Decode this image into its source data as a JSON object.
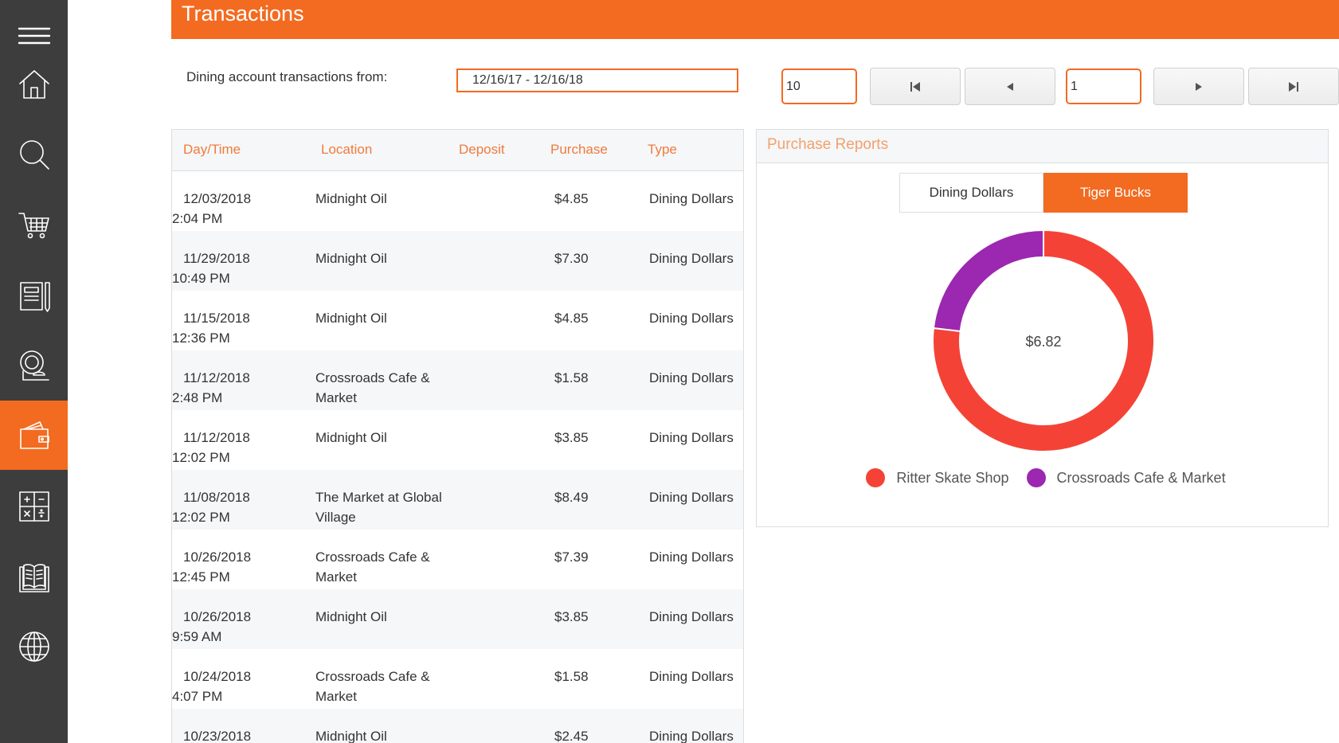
{
  "header": {
    "title": "Transactions"
  },
  "filter": {
    "label": "Dining account transactions from:",
    "date_range": "12/16/17 - 12/16/18"
  },
  "pagination": {
    "page_size": "10",
    "page_number": "1"
  },
  "sidebar": {
    "items": [
      {
        "icon": "menu-icon"
      },
      {
        "icon": "home-icon"
      },
      {
        "icon": "search-icon"
      },
      {
        "icon": "cart-icon"
      },
      {
        "icon": "notebook-icon"
      },
      {
        "icon": "dining-icon"
      },
      {
        "icon": "wallet-icon",
        "active": true
      },
      {
        "icon": "calculator-icon"
      },
      {
        "icon": "book-icon"
      },
      {
        "icon": "globe-icon"
      }
    ]
  },
  "table": {
    "headers": [
      "Day/Time",
      "Location",
      "Deposit",
      "Purchase",
      "Type"
    ],
    "rows": [
      {
        "date": "12/03/2018",
        "time": "2:04 PM",
        "location": "Midnight Oil",
        "deposit": "",
        "purchase": "$4.85",
        "type": "Dining Dollars"
      },
      {
        "date": "11/29/2018",
        "time": "10:49 PM",
        "location": "Midnight Oil",
        "deposit": "",
        "purchase": "$7.30",
        "type": "Dining Dollars"
      },
      {
        "date": "11/15/2018",
        "time": "12:36 PM",
        "location": "Midnight Oil",
        "deposit": "",
        "purchase": "$4.85",
        "type": "Dining Dollars"
      },
      {
        "date": "11/12/2018",
        "time": "2:48 PM",
        "location": "Crossroads Cafe & Market",
        "deposit": "",
        "purchase": "$1.58",
        "type": "Dining Dollars"
      },
      {
        "date": "11/12/2018",
        "time": "12:02 PM",
        "location": "Midnight Oil",
        "deposit": "",
        "purchase": "$3.85",
        "type": "Dining Dollars"
      },
      {
        "date": "11/08/2018",
        "time": "12:02 PM",
        "location": "The Market at Global Village",
        "deposit": "",
        "purchase": "$8.49",
        "type": "Dining Dollars"
      },
      {
        "date": "10/26/2018",
        "time": "12:45 PM",
        "location": "Crossroads Cafe & Market",
        "deposit": "",
        "purchase": "$7.39",
        "type": "Dining Dollars"
      },
      {
        "date": "10/26/2018",
        "time": "9:59 AM",
        "location": "Midnight Oil",
        "deposit": "",
        "purchase": "$3.85",
        "type": "Dining Dollars"
      },
      {
        "date": "10/24/2018",
        "time": "4:07 PM",
        "location": "Crossroads Cafe & Market",
        "deposit": "",
        "purchase": "$1.58",
        "type": "Dining Dollars"
      },
      {
        "date": "10/23/2018",
        "time": "",
        "location": "Midnight Oil",
        "deposit": "",
        "purchase": "$2.45",
        "type": "Dining Dollars"
      }
    ]
  },
  "report": {
    "title": "Purchase Reports",
    "tabs": [
      {
        "label": "Dining Dollars",
        "active": false
      },
      {
        "label": "Tiger Bucks",
        "active": true
      }
    ],
    "center_label": "$6.82",
    "legend": [
      {
        "label": "Ritter Skate Shop",
        "color": "#f44336"
      },
      {
        "label": "Crossroads Cafe & Market",
        "color": "#9c27b0"
      }
    ]
  },
  "chart_data": {
    "type": "pie",
    "categories": [
      "Ritter Skate Shop",
      "Crossroads Cafe & Market"
    ],
    "values": [
      5.24,
      1.58
    ],
    "colors": [
      "#f44336",
      "#9c27b0"
    ],
    "center_label": "$6.82"
  },
  "colors": {
    "accent": "#f26b21",
    "sidebar": "#3d3d3d"
  }
}
